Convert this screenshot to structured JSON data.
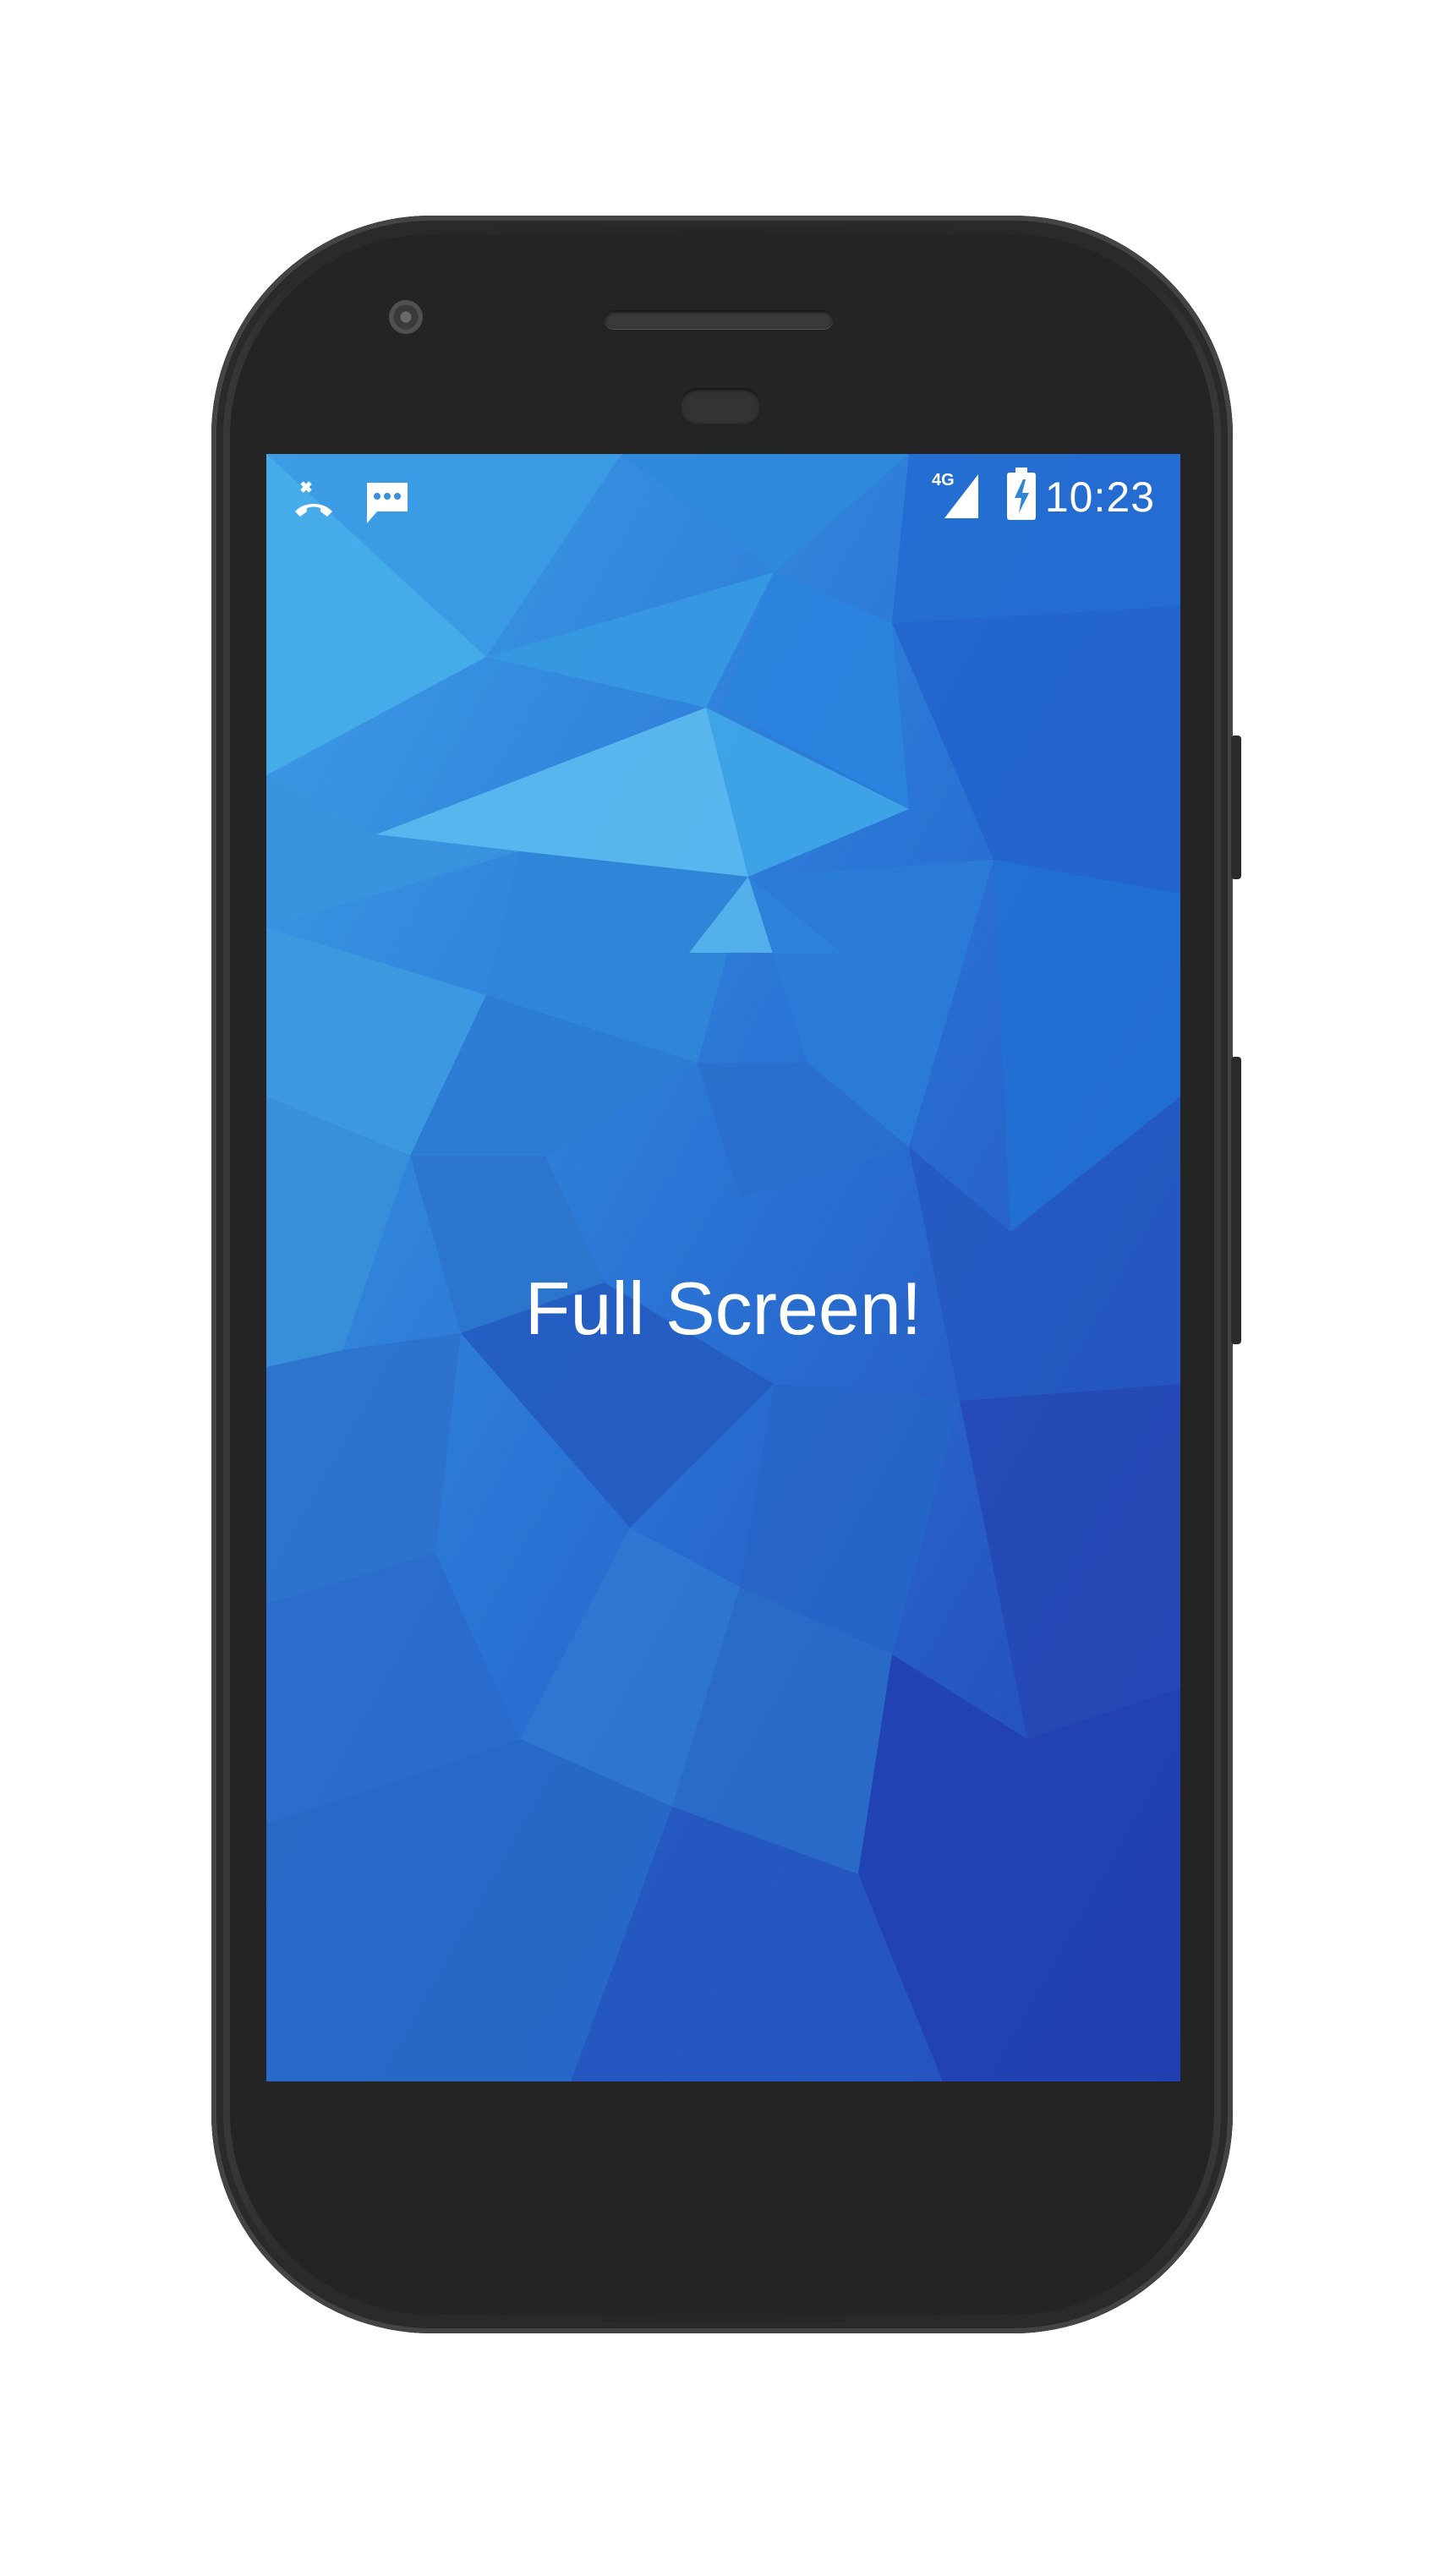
{
  "status_bar": {
    "notification_icons": [
      "missed-call-icon",
      "sms-icon"
    ],
    "network_label": "4G",
    "signal_icon": "signal-icon",
    "battery_icon": "battery-charging-icon",
    "time": "10:23"
  },
  "main": {
    "message": "Full Screen!"
  },
  "colors": {
    "wallpaper_primary": "#2a6fd0",
    "wallpaper_light": "#4fb4ec",
    "wallpaper_dark": "#2545b8",
    "phone_body": "#242424",
    "text": "#ffffff"
  }
}
